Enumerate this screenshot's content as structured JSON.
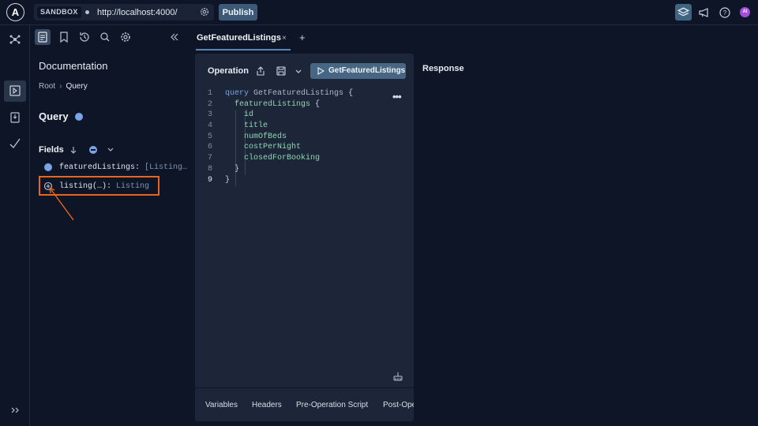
{
  "topbar": {
    "logo_letter": "A",
    "sandbox_label": "SANDBOX",
    "url_value": "http://localhost:4000/",
    "publish_label": "Publish",
    "avatar_initials": "AI"
  },
  "doc": {
    "title": "Documentation",
    "breadcrumb_root": "Root",
    "breadcrumb_sep": "›",
    "breadcrumb_current": "Query",
    "query_title": "Query",
    "fields_label": "Fields",
    "fields": [
      {
        "name": "featuredListings:",
        "type": "[Listing…"
      },
      {
        "name": "listing(…):",
        "type": "Listing"
      }
    ]
  },
  "tabs": [
    {
      "label": "GetFeaturedListings",
      "close": "×"
    }
  ],
  "tab_add": "+",
  "operation": {
    "title": "Operation",
    "run_label": "GetFeaturedListings",
    "code": [
      {
        "n": "1",
        "parts": [
          [
            "kw",
            "query"
          ],
          [
            "sp",
            " "
          ],
          [
            "op-name",
            "GetFeaturedListings"
          ],
          [
            "sp",
            " "
          ],
          [
            "brace",
            "{"
          ]
        ]
      },
      {
        "n": "2",
        "parts": [
          [
            "sp",
            "  "
          ],
          [
            "fld",
            "featuredListings"
          ],
          [
            "sp",
            " "
          ],
          [
            "brace",
            "{"
          ]
        ]
      },
      {
        "n": "3",
        "parts": [
          [
            "sp",
            "    "
          ],
          [
            "fld",
            "id"
          ]
        ]
      },
      {
        "n": "4",
        "parts": [
          [
            "sp",
            "    "
          ],
          [
            "fld",
            "title"
          ]
        ]
      },
      {
        "n": "5",
        "parts": [
          [
            "sp",
            "    "
          ],
          [
            "fld",
            "numOfBeds"
          ]
        ]
      },
      {
        "n": "6",
        "parts": [
          [
            "sp",
            "    "
          ],
          [
            "fld",
            "costPerNight"
          ]
        ]
      },
      {
        "n": "7",
        "parts": [
          [
            "sp",
            "    "
          ],
          [
            "fld",
            "closedForBooking"
          ]
        ]
      },
      {
        "n": "8",
        "parts": [
          [
            "sp",
            "  "
          ],
          [
            "brace",
            "}"
          ]
        ]
      },
      {
        "n": "9",
        "parts": [
          [
            "brace",
            "}"
          ]
        ]
      }
    ],
    "bottom_tabs": [
      "Variables",
      "Headers",
      "Pre-Operation Script",
      "Post-Operation Script"
    ]
  },
  "response": {
    "title": "Response"
  },
  "colors": {
    "accent": "#466684",
    "highlight": "#e9641c",
    "field": "#8fd6b1",
    "keyword": "#78a1e6"
  }
}
